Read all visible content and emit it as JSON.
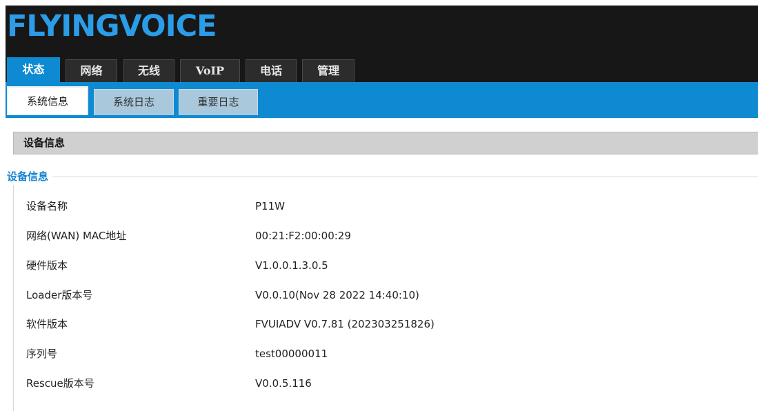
{
  "brand": {
    "logo_text": "FLYINGVOICE",
    "logo_color": "#2b9de8"
  },
  "main_tabs": [
    {
      "label": "状态",
      "active": true
    },
    {
      "label": "网络",
      "active": false
    },
    {
      "label": "无线",
      "active": false
    },
    {
      "label": "VoIP",
      "active": false
    },
    {
      "label": "电话",
      "active": false
    },
    {
      "label": "管理",
      "active": false
    }
  ],
  "sub_tabs": [
    {
      "label": "系统信息",
      "active": true
    },
    {
      "label": "系统日志",
      "active": false
    },
    {
      "label": "重要日志",
      "active": false
    }
  ],
  "section": {
    "header": "设备信息",
    "group_title": "设备信息"
  },
  "device_info": [
    {
      "label": "设备名称",
      "value": "P11W"
    },
    {
      "label": "网络(WAN) MAC地址",
      "value": "00:21:F2:00:00:29"
    },
    {
      "label": "硬件版本",
      "value": "V1.0.0.1.3.0.5"
    },
    {
      "label": "Loader版本号",
      "value": "V0.0.10(Nov 28 2022 14:40:10)"
    },
    {
      "label": "软件版本",
      "value": "FVUIADV V0.7.81 (202303251826)"
    },
    {
      "label": "序列号",
      "value": "test00000011"
    },
    {
      "label": "Rescue版本号",
      "value": "V0.0.5.116"
    }
  ],
  "colors": {
    "accent": "#0e8ad2",
    "topbar": "#171717",
    "header_gray": "#d0d0d0"
  }
}
